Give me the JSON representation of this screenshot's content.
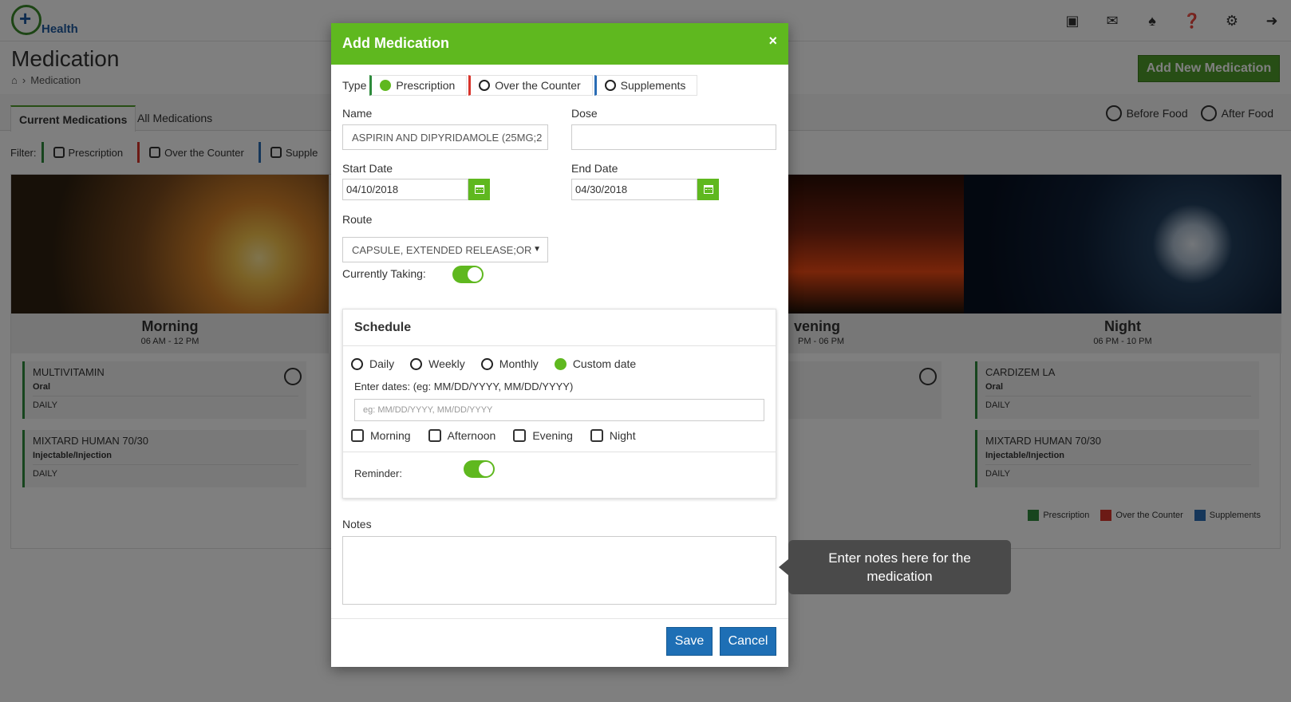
{
  "app": {
    "logo_text": "Health"
  },
  "header_icons": [
    "news-icon",
    "mail-icon",
    "bell-icon",
    "help-icon",
    "gear-icon",
    "logout-icon"
  ],
  "page": {
    "title": "Medication",
    "breadcrumb": "Medication",
    "add_button": "Add New Medication"
  },
  "tabs": [
    "Current Medications",
    "All Medications"
  ],
  "food_legend": [
    "Before Food",
    "After Food"
  ],
  "filter": {
    "label": "Filter:",
    "options": [
      "Prescription",
      "Over the Counter",
      "Supple"
    ]
  },
  "panels": [
    {
      "name": "Morning",
      "time": "06 AM - 12 PM",
      "meds": [
        {
          "name": "MULTIVITAMIN",
          "route": "Oral",
          "freq": "DAILY"
        },
        {
          "name": "MIXTARD HUMAN 70/30",
          "route": "Injectable/Injection",
          "freq": "DAILY"
        }
      ]
    },
    {
      "name": "vening",
      "time": "PM - 06 PM"
    },
    {
      "name": "Night",
      "time": "06 PM - 10 PM",
      "meds": [
        {
          "name": "CARDIZEM LA",
          "route": "Oral",
          "freq": "DAILY"
        },
        {
          "name": "MIXTARD HUMAN 70/30",
          "route": "Injectable/Injection",
          "freq": "DAILY"
        }
      ]
    }
  ],
  "type_legend": [
    "Prescription",
    "Over the Counter",
    "Supplements"
  ],
  "colors": {
    "prescription": "#2e8b3c",
    "otc": "#d9342b",
    "supplements": "#2a6db5",
    "accent": "#5fb81f",
    "primary_button": "#1e6fb5"
  },
  "modal": {
    "title": "Add Medication",
    "close": "×",
    "type_label": "Type",
    "types": [
      {
        "label": "Prescription",
        "selected": true
      },
      {
        "label": "Over the Counter",
        "selected": false
      },
      {
        "label": "Supplements",
        "selected": false
      }
    ],
    "name_label": "Name",
    "name_value": "ASPIRIN AND DIPYRIDAMOLE (25MG;2",
    "dose_label": "Dose",
    "dose_value": "",
    "start_label": "Start Date",
    "start_value": "04/10/2018",
    "end_label": "End Date",
    "end_value": "04/30/2018",
    "route_label": "Route",
    "route_value": "CAPSULE, EXTENDED RELEASE;OR",
    "currently_taking_label": "Currently Taking:",
    "currently_taking": true,
    "schedule": {
      "title": "Schedule",
      "frequencies": [
        {
          "label": "Daily",
          "selected": false
        },
        {
          "label": "Weekly",
          "selected": false
        },
        {
          "label": "Monthly",
          "selected": false
        },
        {
          "label": "Custom date",
          "selected": true
        }
      ],
      "dates_label": "Enter dates: (eg: MM/DD/YYYY, MM/DD/YYYY)",
      "dates_placeholder": "eg: MM/DD/YYYY, MM/DD/YYYY",
      "times": [
        "Morning",
        "Afternoon",
        "Evening",
        "Night"
      ],
      "reminder_label": "Reminder:",
      "reminder": true
    },
    "notes_label": "Notes",
    "save": "Save",
    "cancel": "Cancel"
  },
  "tooltip": "Enter notes here for the medication"
}
